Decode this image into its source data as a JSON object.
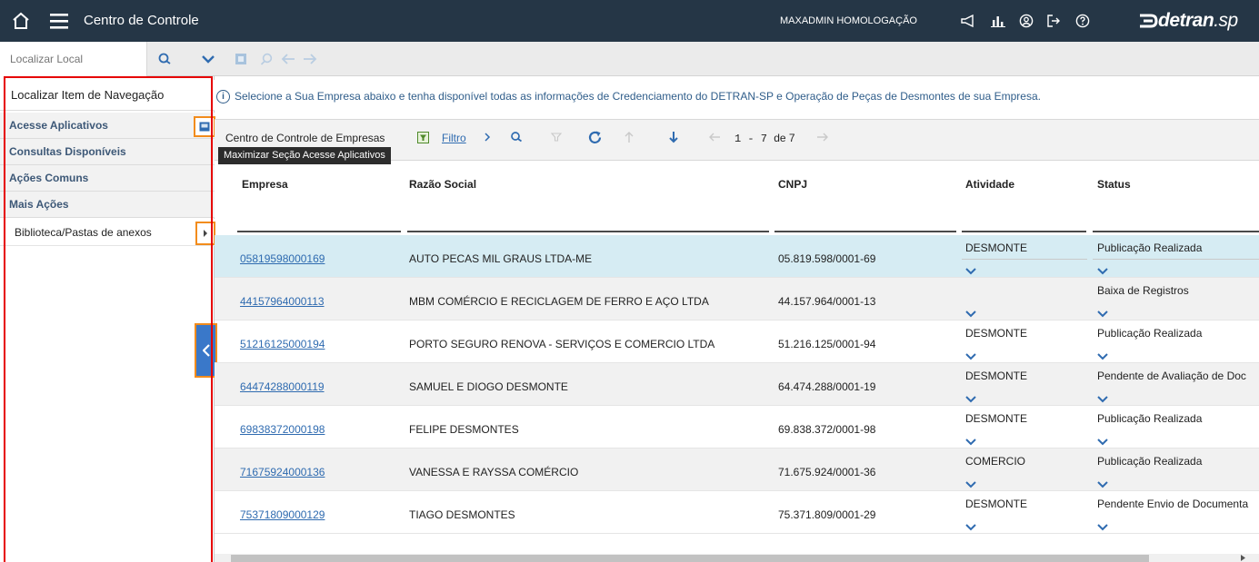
{
  "topbar": {
    "title": "Centro de Controle",
    "user": "MAXADMIN HOMOLOGAÇÃO",
    "brand": "detran",
    "brand_suffix": ".sp"
  },
  "toolbar": {
    "locate_placeholder": "Localizar Local"
  },
  "nav": {
    "locate_label": "Localizar Item de Navegação",
    "sections": [
      {
        "label": "Acesse Aplicativos"
      },
      {
        "label": "Consultas Disponíveis"
      },
      {
        "label": "Ações Comuns"
      },
      {
        "label": "Mais Ações"
      }
    ],
    "item_library": "Biblioteca/Pastas de anexos",
    "tooltip": "Maximizar Seção Acesse Aplicativos"
  },
  "info": {
    "text": "Selecione a Sua Empresa abaixo e tenha disponível todas as informações de Credenciamento do DETRAN-SP e Operação de Peças de Desmontes de sua Empresa."
  },
  "grid": {
    "title": "Centro de Controle de Empresas",
    "filter_label": "Filtro",
    "pager_range": "1 - 7",
    "pager_of": "de 7",
    "columns": {
      "empresa": "Empresa",
      "razao": "Razão Social",
      "cnpj": "CNPJ",
      "atividade": "Atividade",
      "status": "Status"
    },
    "rows": [
      {
        "empresa": "05819598000169",
        "razao": "AUTO PECAS MIL GRAUS LTDA-ME",
        "cnpj": "05.819.598/0001-69",
        "atividade": "DESMONTE",
        "status": "Publicação Realizada"
      },
      {
        "empresa": "44157964000113",
        "razao": "MBM COMÉRCIO E RECICLAGEM DE FERRO E AÇO LTDA",
        "cnpj": "44.157.964/0001-13",
        "atividade": "",
        "status": "Baixa de Registros"
      },
      {
        "empresa": "51216125000194",
        "razao": "PORTO SEGURO RENOVA - SERVIÇOS E COMERCIO LTDA",
        "cnpj": "51.216.125/0001-94",
        "atividade": "DESMONTE",
        "status": "Publicação Realizada"
      },
      {
        "empresa": "64474288000119",
        "razao": "SAMUEL E DIOGO DESMONTE",
        "cnpj": "64.474.288/0001-19",
        "atividade": "DESMONTE",
        "status": "Pendente de Avaliação de Doc"
      },
      {
        "empresa": "69838372000198",
        "razao": "FELIPE DESMONTES",
        "cnpj": "69.838.372/0001-98",
        "atividade": "DESMONTE",
        "status": "Publicação Realizada"
      },
      {
        "empresa": "71675924000136",
        "razao": "VANESSA E RAYSSA COMÉRCIO",
        "cnpj": "71.675.924/0001-36",
        "atividade": "COMERCIO",
        "status": "Publicação Realizada"
      },
      {
        "empresa": "75371809000129",
        "razao": "TIAGO DESMONTES",
        "cnpj": "75.371.809/0001-29",
        "atividade": "DESMONTE",
        "status": "Pendente Envio de Documenta"
      }
    ]
  },
  "colors": {
    "topbar": "#253646",
    "accent": "#2f6bb0",
    "selected_row": "#d6ecf3",
    "highlight_red": "#e60000",
    "highlight_orange": "#f28c1c"
  }
}
